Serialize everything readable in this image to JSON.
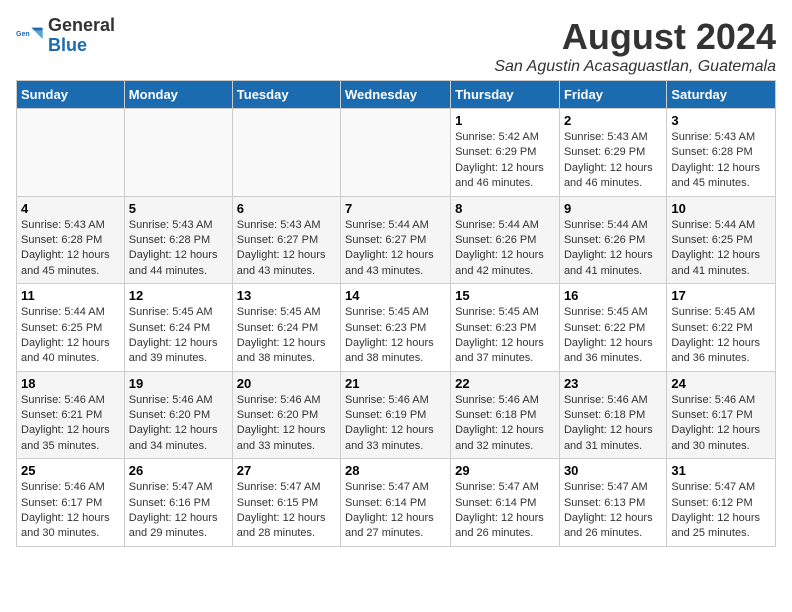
{
  "logo": {
    "general": "General",
    "blue": "Blue"
  },
  "title": "August 2024",
  "subtitle": "San Agustin Acasaguastlan, Guatemala",
  "days_of_week": [
    "Sunday",
    "Monday",
    "Tuesday",
    "Wednesday",
    "Thursday",
    "Friday",
    "Saturday"
  ],
  "weeks": [
    [
      {
        "day": "",
        "info": ""
      },
      {
        "day": "",
        "info": ""
      },
      {
        "day": "",
        "info": ""
      },
      {
        "day": "",
        "info": ""
      },
      {
        "day": "1",
        "info": "Sunrise: 5:42 AM\nSunset: 6:29 PM\nDaylight: 12 hours and 46 minutes."
      },
      {
        "day": "2",
        "info": "Sunrise: 5:43 AM\nSunset: 6:29 PM\nDaylight: 12 hours and 46 minutes."
      },
      {
        "day": "3",
        "info": "Sunrise: 5:43 AM\nSunset: 6:28 PM\nDaylight: 12 hours and 45 minutes."
      }
    ],
    [
      {
        "day": "4",
        "info": "Sunrise: 5:43 AM\nSunset: 6:28 PM\nDaylight: 12 hours and 45 minutes."
      },
      {
        "day": "5",
        "info": "Sunrise: 5:43 AM\nSunset: 6:28 PM\nDaylight: 12 hours and 44 minutes."
      },
      {
        "day": "6",
        "info": "Sunrise: 5:43 AM\nSunset: 6:27 PM\nDaylight: 12 hours and 43 minutes."
      },
      {
        "day": "7",
        "info": "Sunrise: 5:44 AM\nSunset: 6:27 PM\nDaylight: 12 hours and 43 minutes."
      },
      {
        "day": "8",
        "info": "Sunrise: 5:44 AM\nSunset: 6:26 PM\nDaylight: 12 hours and 42 minutes."
      },
      {
        "day": "9",
        "info": "Sunrise: 5:44 AM\nSunset: 6:26 PM\nDaylight: 12 hours and 41 minutes."
      },
      {
        "day": "10",
        "info": "Sunrise: 5:44 AM\nSunset: 6:25 PM\nDaylight: 12 hours and 41 minutes."
      }
    ],
    [
      {
        "day": "11",
        "info": "Sunrise: 5:44 AM\nSunset: 6:25 PM\nDaylight: 12 hours and 40 minutes."
      },
      {
        "day": "12",
        "info": "Sunrise: 5:45 AM\nSunset: 6:24 PM\nDaylight: 12 hours and 39 minutes."
      },
      {
        "day": "13",
        "info": "Sunrise: 5:45 AM\nSunset: 6:24 PM\nDaylight: 12 hours and 38 minutes."
      },
      {
        "day": "14",
        "info": "Sunrise: 5:45 AM\nSunset: 6:23 PM\nDaylight: 12 hours and 38 minutes."
      },
      {
        "day": "15",
        "info": "Sunrise: 5:45 AM\nSunset: 6:23 PM\nDaylight: 12 hours and 37 minutes."
      },
      {
        "day": "16",
        "info": "Sunrise: 5:45 AM\nSunset: 6:22 PM\nDaylight: 12 hours and 36 minutes."
      },
      {
        "day": "17",
        "info": "Sunrise: 5:45 AM\nSunset: 6:22 PM\nDaylight: 12 hours and 36 minutes."
      }
    ],
    [
      {
        "day": "18",
        "info": "Sunrise: 5:46 AM\nSunset: 6:21 PM\nDaylight: 12 hours and 35 minutes."
      },
      {
        "day": "19",
        "info": "Sunrise: 5:46 AM\nSunset: 6:20 PM\nDaylight: 12 hours and 34 minutes."
      },
      {
        "day": "20",
        "info": "Sunrise: 5:46 AM\nSunset: 6:20 PM\nDaylight: 12 hours and 33 minutes."
      },
      {
        "day": "21",
        "info": "Sunrise: 5:46 AM\nSunset: 6:19 PM\nDaylight: 12 hours and 33 minutes."
      },
      {
        "day": "22",
        "info": "Sunrise: 5:46 AM\nSunset: 6:18 PM\nDaylight: 12 hours and 32 minutes."
      },
      {
        "day": "23",
        "info": "Sunrise: 5:46 AM\nSunset: 6:18 PM\nDaylight: 12 hours and 31 minutes."
      },
      {
        "day": "24",
        "info": "Sunrise: 5:46 AM\nSunset: 6:17 PM\nDaylight: 12 hours and 30 minutes."
      }
    ],
    [
      {
        "day": "25",
        "info": "Sunrise: 5:46 AM\nSunset: 6:17 PM\nDaylight: 12 hours and 30 minutes."
      },
      {
        "day": "26",
        "info": "Sunrise: 5:47 AM\nSunset: 6:16 PM\nDaylight: 12 hours and 29 minutes."
      },
      {
        "day": "27",
        "info": "Sunrise: 5:47 AM\nSunset: 6:15 PM\nDaylight: 12 hours and 28 minutes."
      },
      {
        "day": "28",
        "info": "Sunrise: 5:47 AM\nSunset: 6:14 PM\nDaylight: 12 hours and 27 minutes."
      },
      {
        "day": "29",
        "info": "Sunrise: 5:47 AM\nSunset: 6:14 PM\nDaylight: 12 hours and 26 minutes."
      },
      {
        "day": "30",
        "info": "Sunrise: 5:47 AM\nSunset: 6:13 PM\nDaylight: 12 hours and 26 minutes."
      },
      {
        "day": "31",
        "info": "Sunrise: 5:47 AM\nSunset: 6:12 PM\nDaylight: 12 hours and 25 minutes."
      }
    ]
  ]
}
